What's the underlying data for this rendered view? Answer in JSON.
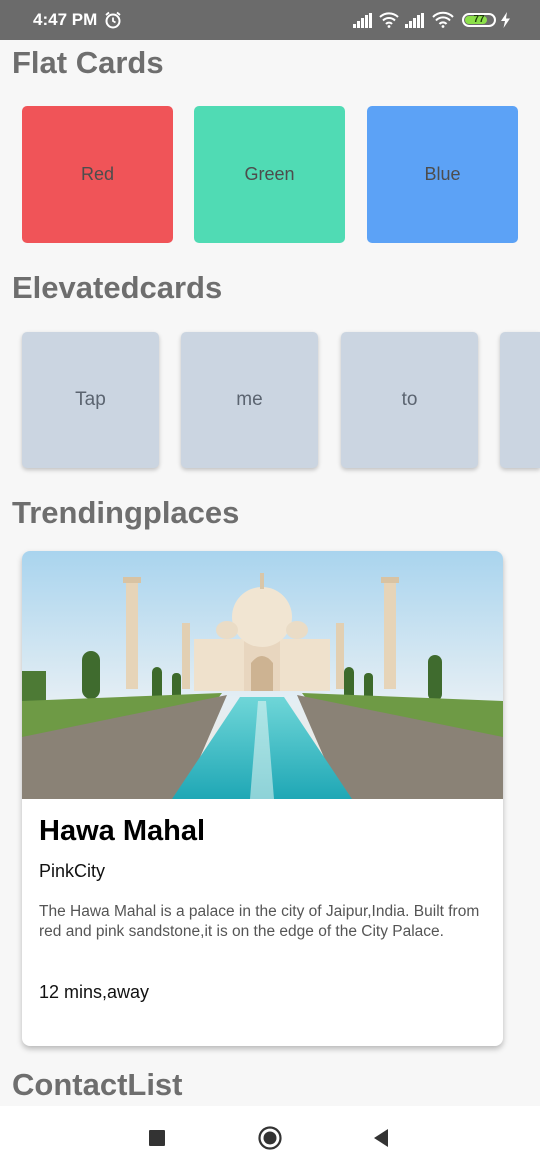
{
  "status_bar": {
    "time": "4:47 PM",
    "battery_level": "77",
    "battery_fraction": 0.77,
    "icons": [
      "alarm-icon",
      "signal-icon",
      "wifi-icon",
      "signal-icon",
      "wifi-icon",
      "battery-icon",
      "charging-bolt-icon"
    ]
  },
  "flat_cards": {
    "title": "Flat Cards",
    "cards": [
      {
        "label": "Red",
        "color": "#f05458"
      },
      {
        "label": "Green",
        "color": "#50dbb4"
      },
      {
        "label": "Blue",
        "color": "#5ca2f6"
      }
    ]
  },
  "elevated_cards": {
    "title": "Elevatedcards",
    "cards": [
      "Tap",
      "me",
      "to",
      ""
    ],
    "color": "#cbd5e1"
  },
  "trending": {
    "title": "Trendingplaces",
    "card": {
      "name": "Hawa Mahal",
      "label": "PinkCity",
      "description": "The Hawa Mahal is a palace in the city of Jaipur,India. Built from red and pink sandstone,it is on the edge of the City Palace.",
      "time": "12 mins,away"
    }
  },
  "contact_list": {
    "title": "ContactList"
  },
  "nav_bar": {
    "icons": [
      "recents-square-icon",
      "home-circle-icon",
      "back-triangle-icon"
    ]
  }
}
